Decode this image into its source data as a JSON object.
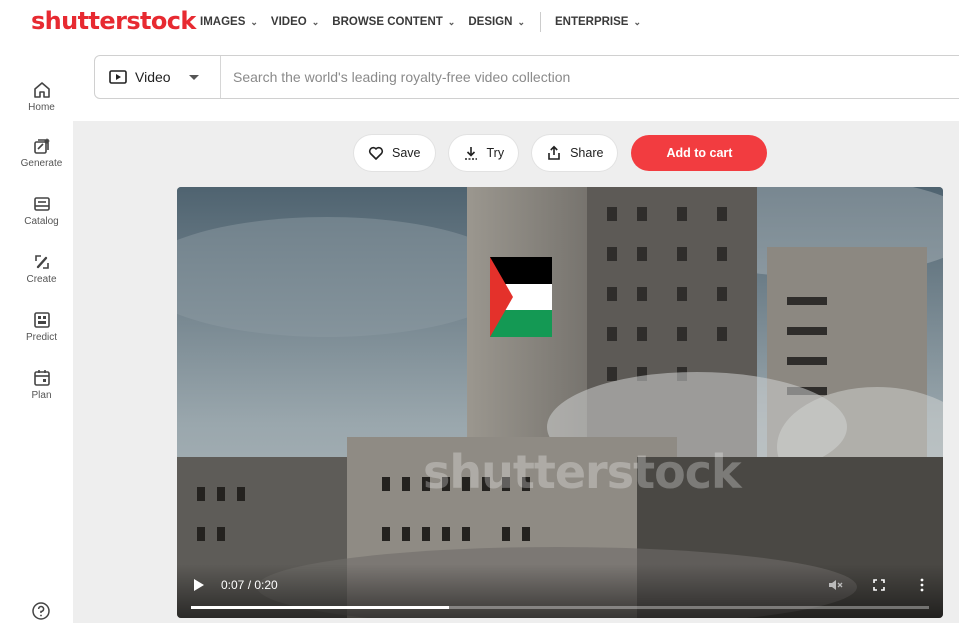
{
  "brand": {
    "logo_text": "shutterstock",
    "color": "#e72a31"
  },
  "nav": {
    "items": [
      {
        "label": "IMAGES"
      },
      {
        "label": "VIDEO"
      },
      {
        "label": "BROWSE CONTENT"
      },
      {
        "label": "DESIGN"
      },
      {
        "label": "ENTERPRISE"
      }
    ]
  },
  "sidebar": {
    "items": [
      {
        "label": "Home",
        "icon": "home-icon"
      },
      {
        "label": "Generate",
        "icon": "generate-icon"
      },
      {
        "label": "Catalog",
        "icon": "catalog-icon"
      },
      {
        "label": "Create",
        "icon": "create-icon"
      },
      {
        "label": "Predict",
        "icon": "predict-icon"
      },
      {
        "label": "Plan",
        "icon": "plan-icon"
      }
    ],
    "help_icon": "help-icon"
  },
  "search": {
    "type_label": "Video",
    "placeholder": "Search the world's leading royalty-free video collection",
    "value": ""
  },
  "actions": {
    "save_label": "Save",
    "try_label": "Try",
    "share_label": "Share",
    "cart_label": "Add to cart",
    "cart_color": "#f23c40"
  },
  "player": {
    "watermark": "shutterstock",
    "time": "0:07 / 0:20",
    "progress_fraction": 0.35,
    "icons": [
      "play-icon",
      "mute-icon",
      "fullscreen-icon",
      "more-options-icon"
    ]
  }
}
